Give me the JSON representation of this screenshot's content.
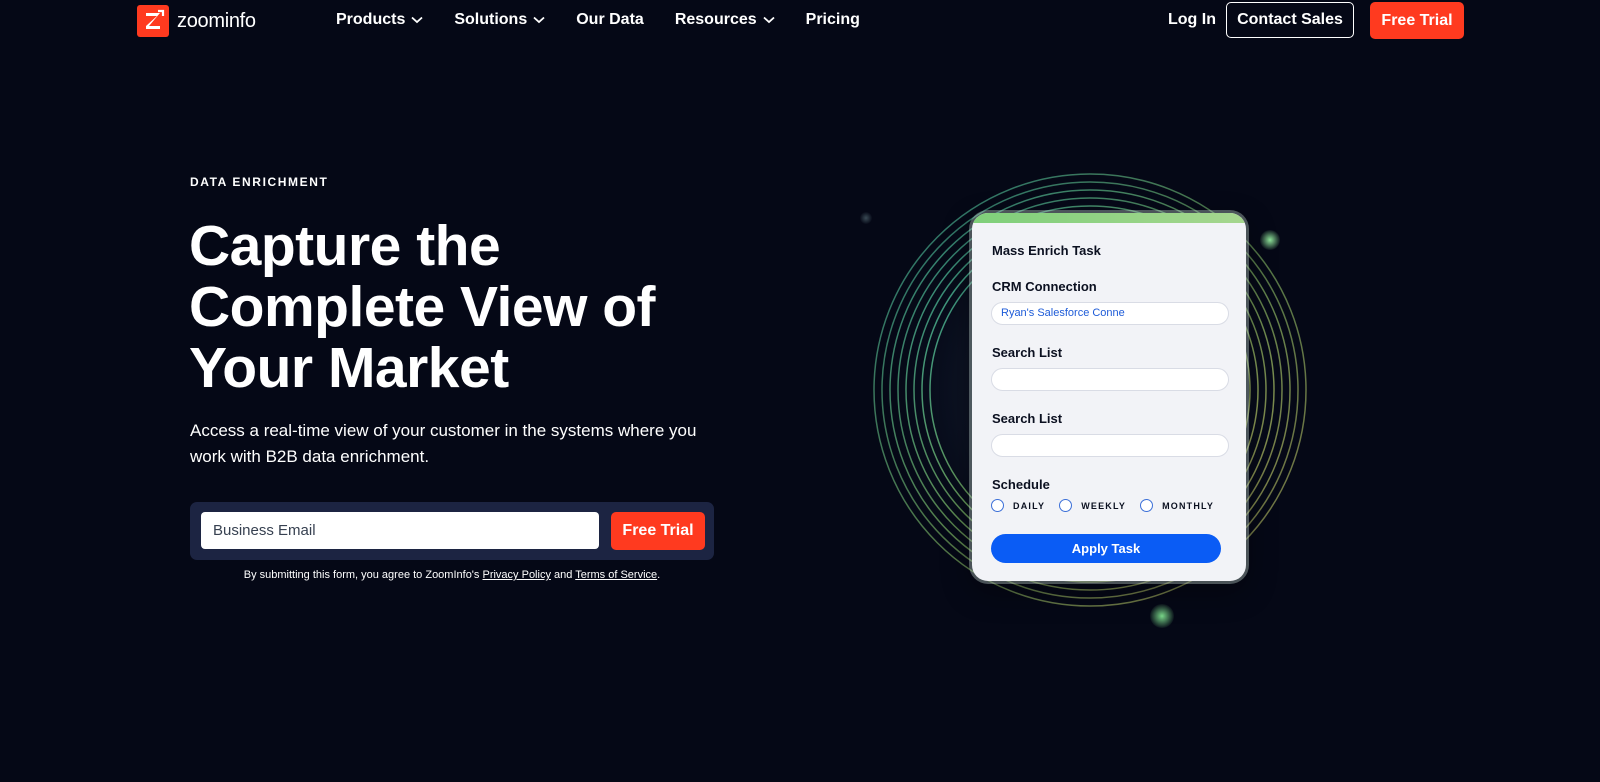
{
  "brand": {
    "name": "zoominfo",
    "accent": "#ff3a1f",
    "background": "#050816"
  },
  "nav": {
    "items": [
      {
        "label": "Products",
        "has_dropdown": true
      },
      {
        "label": "Solutions",
        "has_dropdown": true
      },
      {
        "label": "Our Data",
        "has_dropdown": false
      },
      {
        "label": "Resources",
        "has_dropdown": true
      },
      {
        "label": "Pricing",
        "has_dropdown": false
      }
    ],
    "login_label": "Log In",
    "contact_label": "Contact Sales",
    "trial_label": "Free Trial"
  },
  "hero": {
    "eyebrow": "DATA ENRICHMENT",
    "headline_line1": "Capture the",
    "headline_line2": "Complete View of",
    "headline_line3": "Your Market",
    "subtext": "Access a real-time view of your customer in the systems where you work with B2B data enrichment.",
    "email_placeholder": "Business Email",
    "submit_label": "Free Trial",
    "disclaimer_prefix": "By submitting this form, you agree to ZoomInfo's",
    "privacy_label": "Privacy Policy",
    "disclaimer_and": "and",
    "terms_label": "Terms of Service",
    "disclaimer_suffix": "."
  },
  "task_card": {
    "title": "Mass Enrich Task",
    "crm_label": "CRM Connection",
    "crm_value": "Ryan's Salesforce Conne",
    "search_list_1_label": "Search List",
    "search_list_2_label": "Search List",
    "schedule_label": "Schedule",
    "schedule_options": [
      "DAILY",
      "WEEKLY",
      "MONTHLY"
    ],
    "apply_label": "Apply Task",
    "apply_color": "#0a5cf5"
  },
  "icons": {
    "logo": "zoominfo-z-logo-icon",
    "dropdown": "chevron-down-icon"
  }
}
